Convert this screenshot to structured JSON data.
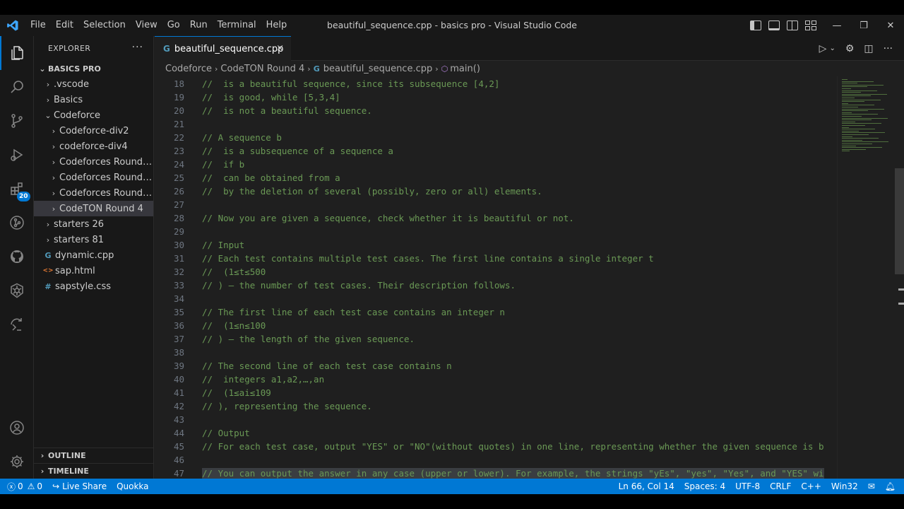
{
  "window": {
    "title": "beautiful_sequence.cpp - basics pro - Visual Studio Code",
    "menu": [
      "File",
      "Edit",
      "Selection",
      "View",
      "Go",
      "Run",
      "Terminal",
      "Help"
    ]
  },
  "activity": {
    "extensions_badge": "20"
  },
  "sidebar": {
    "title": "EXPLORER",
    "more": "···",
    "root": "BASICS PRO",
    "items": [
      {
        "label": ".vscode",
        "type": "folder",
        "open": false,
        "depth": 1
      },
      {
        "label": "Basics",
        "type": "folder",
        "open": false,
        "depth": 1
      },
      {
        "label": "Codeforce",
        "type": "folder",
        "open": true,
        "depth": 1
      },
      {
        "label": "Codeforce-div2",
        "type": "folder",
        "open": false,
        "depth": 2
      },
      {
        "label": "codeforce-div4",
        "type": "folder",
        "open": false,
        "depth": 2
      },
      {
        "label": "Codeforces Round 1...",
        "type": "folder",
        "open": false,
        "depth": 2
      },
      {
        "label": "Codeforces Round 8...",
        "type": "folder",
        "open": false,
        "depth": 2
      },
      {
        "label": "Codeforces Round 8...",
        "type": "folder",
        "open": false,
        "depth": 2
      },
      {
        "label": "CodeTON Round 4",
        "type": "folder",
        "open": false,
        "depth": 2,
        "selected": true
      },
      {
        "label": "starters 26",
        "type": "folder",
        "open": false,
        "depth": 1
      },
      {
        "label": "starters 81",
        "type": "folder",
        "open": false,
        "depth": 1
      },
      {
        "label": "dynamic.cpp",
        "type": "cpp",
        "depth": 1
      },
      {
        "label": "sap.html",
        "type": "html",
        "depth": 1
      },
      {
        "label": "sapstyle.css",
        "type": "css",
        "depth": 1
      }
    ],
    "outline": "OUTLINE",
    "timeline": "TIMELINE"
  },
  "editor": {
    "tab_label": "beautiful_sequence.cpp",
    "tab_close": "×",
    "breadcrumb": [
      "Codeforce",
      "CodeTON Round 4",
      "beautiful_sequence.cpp",
      "main()"
    ],
    "lines": [
      {
        "n": "18",
        "t": "//  is a beautiful sequence, since its subsequence [4,2]"
      },
      {
        "n": "19",
        "t": "//  is good, while [5,3,4]"
      },
      {
        "n": "20",
        "t": "//  is not a beautiful sequence."
      },
      {
        "n": "21",
        "t": ""
      },
      {
        "n": "22",
        "t": "// A sequence b"
      },
      {
        "n": "23",
        "t": "//  is a subsequence of a sequence a"
      },
      {
        "n": "24",
        "t": "//  if b"
      },
      {
        "n": "25",
        "t": "//  can be obtained from a"
      },
      {
        "n": "26",
        "t": "//  by the deletion of several (possibly, zero or all) elements."
      },
      {
        "n": "27",
        "t": ""
      },
      {
        "n": "28",
        "t": "// Now you are given a sequence, check whether it is beautiful or not."
      },
      {
        "n": "29",
        "t": ""
      },
      {
        "n": "30",
        "t": "// Input"
      },
      {
        "n": "31",
        "t": "// Each test contains multiple test cases. The first line contains a single integer t"
      },
      {
        "n": "32",
        "t": "//  (1≤t≤500"
      },
      {
        "n": "33",
        "t": "// ) — the number of test cases. Their description follows."
      },
      {
        "n": "34",
        "t": ""
      },
      {
        "n": "35",
        "t": "// The first line of each test case contains an integer n"
      },
      {
        "n": "36",
        "t": "//  (1≤n≤100"
      },
      {
        "n": "37",
        "t": "// ) — the length of the given sequence."
      },
      {
        "n": "38",
        "t": ""
      },
      {
        "n": "39",
        "t": "// The second line of each test case contains n"
      },
      {
        "n": "40",
        "t": "//  integers a1,a2,…,an"
      },
      {
        "n": "41",
        "t": "//  (1≤ai≤109"
      },
      {
        "n": "42",
        "t": "// ), representing the sequence."
      },
      {
        "n": "43",
        "t": ""
      },
      {
        "n": "44",
        "t": "// Output"
      },
      {
        "n": "45",
        "t": "// For each test case, output \"YES\" or \"NO\"(without quotes) in one line, representing whether the given sequence is b"
      },
      {
        "n": "46",
        "t": ""
      },
      {
        "n": "47",
        "t": "// You can output the answer in any case (upper or lower). For example, the strings \"yEs\", \"yes\", \"Yes\", and \"YES\" wi",
        "hl": true
      }
    ]
  },
  "status": {
    "problems": "0",
    "warnings": "0",
    "live_share": "Live Share",
    "quokka": "Quokka",
    "position": "Ln 66, Col 14",
    "spaces": "Spaces: 4",
    "encoding": "UTF-8",
    "eol": "CRLF",
    "language": "C++",
    "platform": "Win32"
  },
  "colors": {
    "accent": "#0078d4",
    "comment": "#6a9955",
    "background": "#1f1f1f"
  }
}
